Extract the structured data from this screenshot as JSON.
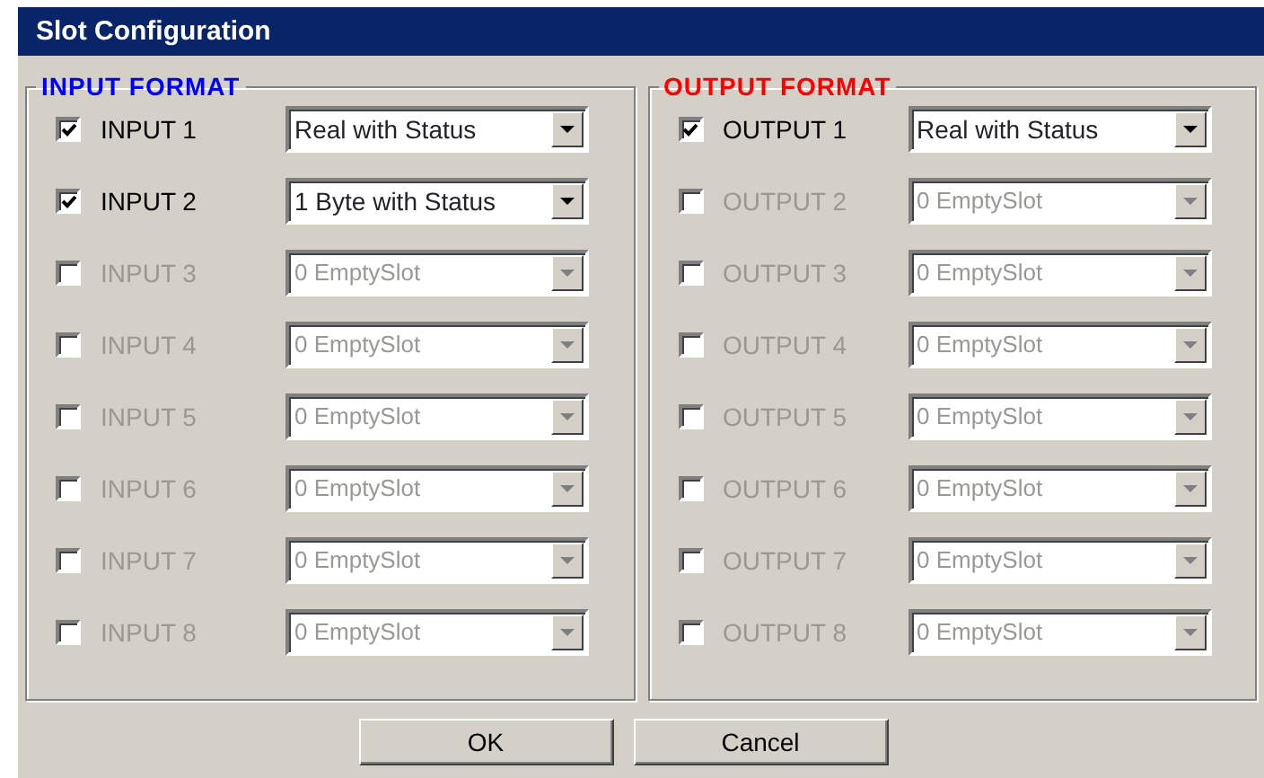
{
  "window": {
    "title": "Slot Configuration"
  },
  "groups": [
    {
      "title": "INPUT FORMAT",
      "color": "#0000ff",
      "slots": [
        {
          "label": "INPUT 1",
          "checked": true,
          "disabled": false,
          "value": "Real with Status"
        },
        {
          "label": "INPUT 2",
          "checked": true,
          "disabled": false,
          "value": "1 Byte with Status"
        },
        {
          "label": "INPUT 3",
          "checked": false,
          "disabled": true,
          "value": "0 EmptySlot"
        },
        {
          "label": "INPUT 4",
          "checked": false,
          "disabled": true,
          "value": "0 EmptySlot"
        },
        {
          "label": "INPUT 5",
          "checked": false,
          "disabled": true,
          "value": "0 EmptySlot"
        },
        {
          "label": "INPUT 6",
          "checked": false,
          "disabled": true,
          "value": "0 EmptySlot"
        },
        {
          "label": "INPUT 7",
          "checked": false,
          "disabled": true,
          "value": "0 EmptySlot"
        },
        {
          "label": "INPUT 8",
          "checked": false,
          "disabled": true,
          "value": "0 EmptySlot"
        }
      ]
    },
    {
      "title": "OUTPUT FORMAT",
      "color": "#ff0000",
      "slots": [
        {
          "label": "OUTPUT 1",
          "checked": true,
          "disabled": false,
          "value": "Real with Status"
        },
        {
          "label": "OUTPUT 2",
          "checked": false,
          "disabled": true,
          "value": "0 EmptySlot"
        },
        {
          "label": "OUTPUT 3",
          "checked": false,
          "disabled": true,
          "value": "0 EmptySlot"
        },
        {
          "label": "OUTPUT 4",
          "checked": false,
          "disabled": true,
          "value": "0 EmptySlot"
        },
        {
          "label": "OUTPUT 5",
          "checked": false,
          "disabled": true,
          "value": "0 EmptySlot"
        },
        {
          "label": "OUTPUT 6",
          "checked": false,
          "disabled": true,
          "value": "0 EmptySlot"
        },
        {
          "label": "OUTPUT 7",
          "checked": false,
          "disabled": true,
          "value": "0 EmptySlot"
        },
        {
          "label": "OUTPUT 8",
          "checked": false,
          "disabled": true,
          "value": "0 EmptySlot"
        }
      ]
    }
  ],
  "buttons": [
    "OK",
    "Cancel"
  ]
}
